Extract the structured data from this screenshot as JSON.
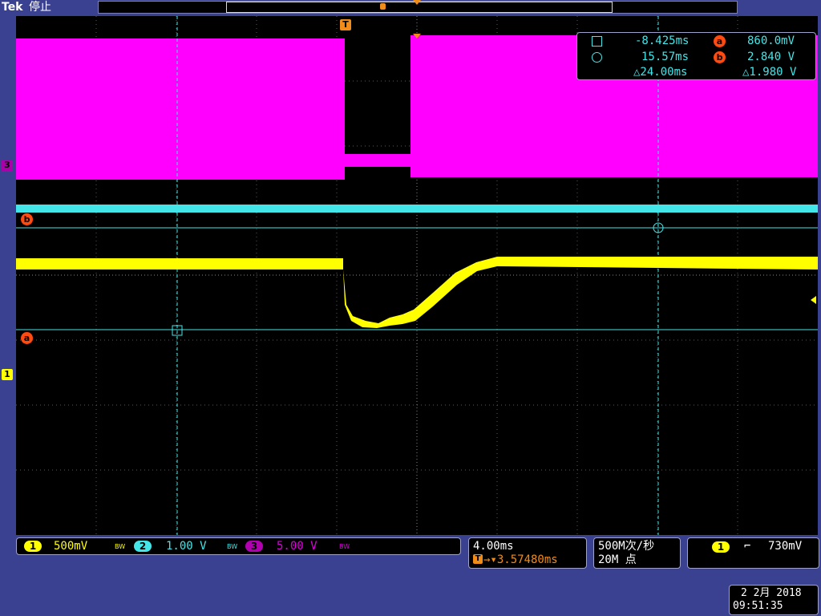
{
  "header": {
    "brand": "Tek",
    "status": "停止"
  },
  "trigger_marker": "T",
  "cursors": {
    "row1": {
      "time": "-8.425ms",
      "badge": "a",
      "volt": "860.0mV"
    },
    "row2": {
      "time": "15.57ms",
      "badge": "b",
      "volt": "2.840 V"
    },
    "row3": {
      "dtime": "△24.00ms",
      "dvolt": "△1.980 V"
    }
  },
  "channel_markers": {
    "ch3": "3",
    "ch1": "1",
    "cursor_a": "a",
    "cursor_b": "b"
  },
  "channels": [
    {
      "id": "1",
      "scale": "500mV",
      "bw": "BW",
      "color": "#ffff00"
    },
    {
      "id": "2",
      "scale": "1.00 V",
      "bw": "BW",
      "color": "#44e5e8"
    },
    {
      "id": "3",
      "scale": "5.00 V",
      "bw": "BW",
      "color": "#dd00dd"
    }
  ],
  "timebase": {
    "scale": "4.00ms",
    "position_icon": "T",
    "position": "→▾3.57480ms"
  },
  "acquisition": {
    "rate": "500M次/秒",
    "points": "20M 点"
  },
  "trigger": {
    "source": "1",
    "slope_icon": "falling-edge-icon",
    "slope_glyph": "⌐",
    "level": "730mV"
  },
  "datetime": {
    "date": "2 2月 2018",
    "time": "09:51:35"
  },
  "colors": {
    "background": "#3b4191",
    "ch1": "#ffff00",
    "ch2": "#44e5e8",
    "ch3": "#ff00ff",
    "cursor": "#44e5e8",
    "trigger": "#f08c1a",
    "badge": "#ff4a10"
  }
}
